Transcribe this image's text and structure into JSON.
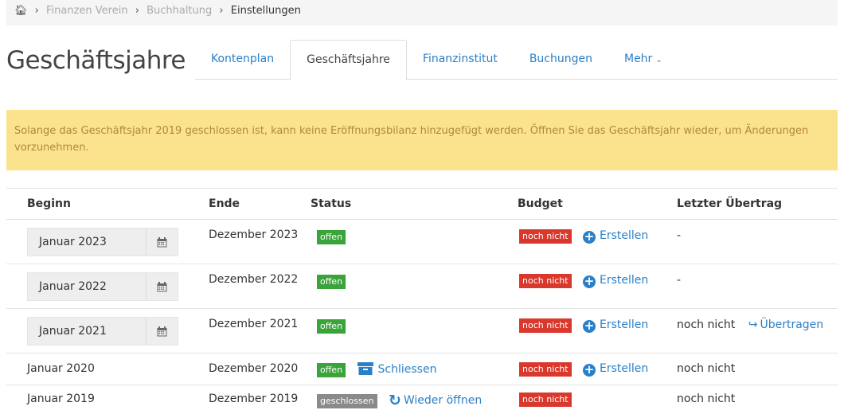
{
  "breadcrumb": {
    "items": [
      "Finanzen Verein",
      "Buchhaltung"
    ],
    "current": "Einstellungen"
  },
  "page_title": "Geschäftsjahre",
  "tabs": [
    "Kontenplan",
    "Geschäftsjahre",
    "Finanzinstitut",
    "Buchungen",
    "Mehr"
  ],
  "alert": "Solange das Geschäftsjahr 2019 geschlossen ist, kann keine Eröffnungsbilanz hinzugefügt werden. Öffnen Sie das Geschäftsjahr wieder, um Änderungen vorzunehmen.",
  "table": {
    "headers": {
      "beginn": "Beginn",
      "ende": "Ende",
      "status": "Status",
      "budget": "Budget",
      "uebertrag": "Letzter Übertrag"
    },
    "rows": [
      {
        "beginn": "Januar 2023",
        "ende": "Dezember 2023",
        "status": "offen",
        "budget": "noch nicht",
        "budget_action": "Erstellen",
        "uebertrag": "-"
      },
      {
        "beginn": "Januar 2022",
        "ende": "Dezember 2022",
        "status": "offen",
        "budget": "noch nicht",
        "budget_action": "Erstellen",
        "uebertrag": "-"
      },
      {
        "beginn": "Januar 2021",
        "ende": "Dezember 2021",
        "status": "offen",
        "budget": "noch nicht",
        "budget_action": "Erstellen",
        "uebertrag": "noch nicht",
        "uebertrag_action": "Übertragen"
      },
      {
        "beginn": "Januar 2020",
        "ende": "Dezember 2020",
        "status": "offen",
        "status_action": "Schliessen",
        "budget": "noch nicht",
        "budget_action": "Erstellen",
        "uebertrag": "noch nicht"
      },
      {
        "beginn": "Januar 2019",
        "ende": "Dezember 2019",
        "status": "geschlossen",
        "status_action": "Wieder öffnen",
        "budget": "noch nicht",
        "uebertrag": "noch nicht"
      }
    ]
  },
  "colors": {
    "link": "#2a80c8",
    "alert_bg": "#fbe38e",
    "alert_text": "#b2873c",
    "badge_open": "#3aa43a",
    "badge_not_yet": "#d9392c",
    "badge_closed": "#8a8a8a"
  },
  "icons": [
    "home-icon",
    "chevron-down-icon",
    "calendar-icon",
    "plus-circle-icon",
    "archive-icon",
    "refresh-icon",
    "share-icon"
  ]
}
